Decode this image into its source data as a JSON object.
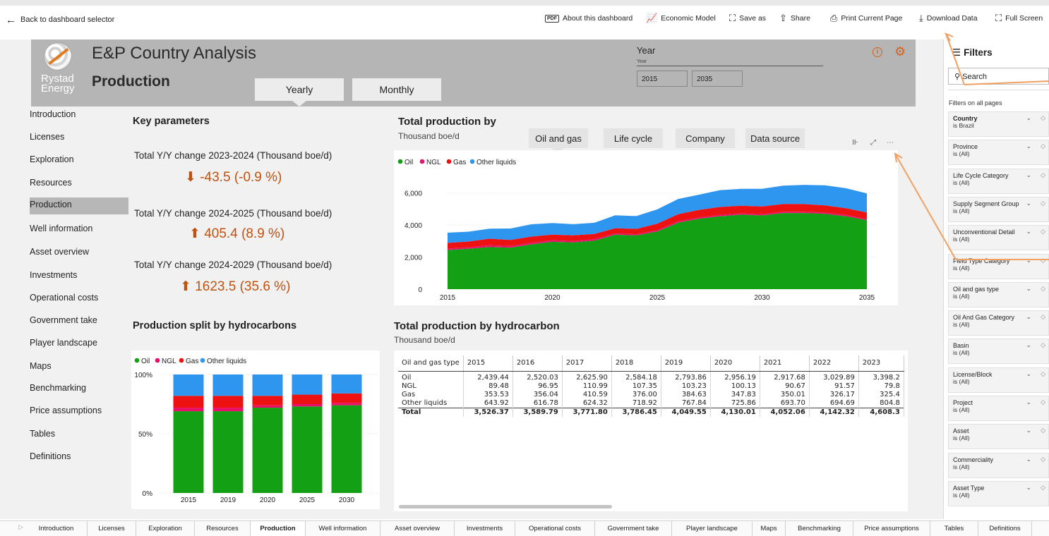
{
  "topbar": {
    "back_label": "Back to dashboard selector",
    "about_label": "About this dashboard",
    "about_icon_text": "PDF",
    "econ_label": "Economic Model",
    "saveas_label": "Save as",
    "share_label": "Share",
    "print_label": "Print Current Page",
    "download_label": "Download Data",
    "fullscreen_label": "Full Screen"
  },
  "header": {
    "logo_line1": "Rystad",
    "logo_line2": "Energy",
    "app_title": "E&P Country Analysis",
    "page_title": "Production",
    "tabs": [
      "Yearly",
      "Monthly"
    ],
    "year_label": "Year",
    "year_sub": "Year",
    "year_start": "2015",
    "year_end": "2035"
  },
  "nav": {
    "items": [
      "Introduction",
      "Licenses",
      "Exploration",
      "Resources",
      "Production",
      "Well information",
      "Asset overview",
      "Investments",
      "Operational costs",
      "Government take",
      "Player landscape",
      "Maps",
      "Benchmarking",
      "Price assumptions",
      "Tables",
      "Definitions"
    ],
    "active": "Production"
  },
  "key_parameters": {
    "title": "Key parameters",
    "items": [
      {
        "label": "Total Y/Y change 2023-2024 (Thousand boe/d)",
        "arrow": "⬇",
        "value": "-43.5 (-0.9 %)"
      },
      {
        "label": "Total Y/Y change 2024-2025 (Thousand boe/d)",
        "arrow": "⬆",
        "value": "405.4 (8.9 %)"
      },
      {
        "label": "Total Y/Y change 2024-2029 (Thousand boe/d)",
        "arrow": "⬆",
        "value": "1623.5 (35.6 %)"
      }
    ]
  },
  "total_production": {
    "title": "Total production by",
    "unit": "Thousand boe/d",
    "segments": [
      "Oil and gas",
      "Life cycle",
      "Company",
      "Data source"
    ]
  },
  "split": {
    "title": "Production split by hydrocarbons"
  },
  "table": {
    "title": "Total production by hydrocarbon",
    "unit": "Thousand boe/d",
    "columns": [
      "Oil and gas type",
      "2015",
      "2016",
      "2017",
      "2018",
      "2019",
      "2020",
      "2021",
      "2022",
      "2023"
    ],
    "rows": [
      [
        "Oil",
        "2,439.44",
        "2,520.03",
        "2,625.90",
        "2,584.18",
        "2,793.86",
        "2,956.19",
        "2,917.68",
        "3,029.89",
        "3,398.2"
      ],
      [
        "NGL",
        "89.48",
        "96.95",
        "110.99",
        "107.35",
        "103.23",
        "100.13",
        "90.67",
        "91.57",
        "79.8"
      ],
      [
        "Gas",
        "353.53",
        "356.04",
        "410.59",
        "376.00",
        "384.63",
        "347.83",
        "350.01",
        "326.17",
        "325.4"
      ],
      [
        "Other liquids",
        "643.92",
        "616.78",
        "624.32",
        "718.92",
        "767.84",
        "725.86",
        "693.70",
        "694.69",
        "804.8"
      ],
      [
        "Total",
        "3,526.37",
        "3,589.79",
        "3,771.80",
        "3,786.45",
        "4,049.55",
        "4,130.01",
        "4,052.06",
        "4,142.32",
        "4,608.3"
      ]
    ]
  },
  "filters": {
    "title": "Filters",
    "search_placeholder": "Search",
    "all_pages_label": "Filters on all pages",
    "cards": [
      {
        "name": "Country",
        "value": "is Brazil",
        "strong": true
      },
      {
        "name": "Province",
        "value": "is (All)"
      },
      {
        "name": "Life Cycle Category",
        "value": "is (All)"
      },
      {
        "name": "Supply Segment Group",
        "value": "is (All)"
      },
      {
        "name": "Unconventional Detail",
        "value": "is (All)"
      },
      {
        "name": "Field Type Category",
        "value": "is (All)"
      },
      {
        "name": "Oil and gas type",
        "value": "is (All)"
      },
      {
        "name": "Oil And Gas Category",
        "value": "is (All)"
      },
      {
        "name": "Basin",
        "value": "is (All)"
      },
      {
        "name": "License/Block",
        "value": "is (All)"
      },
      {
        "name": "Project",
        "value": "is (All)"
      },
      {
        "name": "Asset",
        "value": "is (All)"
      },
      {
        "name": "Commerciality",
        "value": "is (All)"
      },
      {
        "name": "Asset Type",
        "value": "is (All)"
      }
    ]
  },
  "page_tabs": [
    "Introduction",
    "Licenses",
    "Exploration",
    "Resources",
    "Production",
    "Well information",
    "Asset overview",
    "Investments",
    "Operational costs",
    "Government take",
    "Player landscape",
    "Maps",
    "Benchmarking",
    "Price assumptions",
    "Tables",
    "Definitions"
  ],
  "colors": {
    "oil": "#14a014",
    "ngl": "#e8106a",
    "gas": "#ee1111",
    "other_liquids": "#2f96f0",
    "accent": "#c0520f"
  },
  "chart_data": [
    {
      "type": "area",
      "stacked": true,
      "title": "Total production by",
      "ylabel": "Thousand boe/d",
      "x": [
        2015,
        2016,
        2017,
        2018,
        2019,
        2020,
        2021,
        2022,
        2023,
        2024,
        2025,
        2026,
        2027,
        2028,
        2029,
        2030,
        2031,
        2032,
        2033,
        2034,
        2035
      ],
      "series": [
        {
          "name": "Oil",
          "values": [
            2439,
            2520,
            2626,
            2584,
            2794,
            2956,
            2918,
            3030,
            3398,
            3350,
            3600,
            4150,
            4400,
            4550,
            4650,
            4600,
            4750,
            4750,
            4700,
            4550,
            4300
          ]
        },
        {
          "name": "NGL",
          "values": [
            89,
            97,
            111,
            107,
            103,
            100,
            91,
            92,
            80,
            80,
            80,
            80,
            80,
            80,
            80,
            80,
            80,
            80,
            80,
            80,
            80
          ]
        },
        {
          "name": "Gas",
          "values": [
            354,
            356,
            411,
            376,
            385,
            348,
            350,
            326,
            325,
            330,
            400,
            450,
            470,
            500,
            480,
            480,
            480,
            480,
            450,
            420,
            400
          ]
        },
        {
          "name": "Other liquids",
          "values": [
            644,
            617,
            624,
            719,
            768,
            726,
            694,
            695,
            805,
            800,
            900,
            950,
            950,
            1050,
            1050,
            1100,
            1150,
            1200,
            1250,
            1250,
            1200
          ]
        }
      ],
      "ylim": [
        0,
        7000
      ],
      "yticks": [
        "0",
        "2,000",
        "4,000",
        "6,000"
      ],
      "xticks": [
        "2015",
        "2020",
        "2025",
        "2030",
        "2035"
      ],
      "legend": "top-left"
    },
    {
      "type": "bar",
      "stacked": true,
      "title": "Production split by hydrocarbons",
      "categories": [
        "2015",
        "2019",
        "2020",
        "2025",
        "2030"
      ],
      "series": [
        {
          "name": "Oil",
          "values": [
            69,
            69,
            72,
            73,
            74
          ]
        },
        {
          "name": "NGL",
          "values": [
            3,
            3,
            2,
            2,
            2
          ]
        },
        {
          "name": "Gas",
          "values": [
            10,
            10,
            8,
            8,
            8
          ]
        },
        {
          "name": "Other liquids",
          "values": [
            18,
            18,
            18,
            17,
            16
          ]
        }
      ],
      "ylim": [
        0,
        100
      ],
      "yticks": [
        "0%",
        "50%",
        "100%"
      ],
      "legend": "top-left"
    }
  ]
}
